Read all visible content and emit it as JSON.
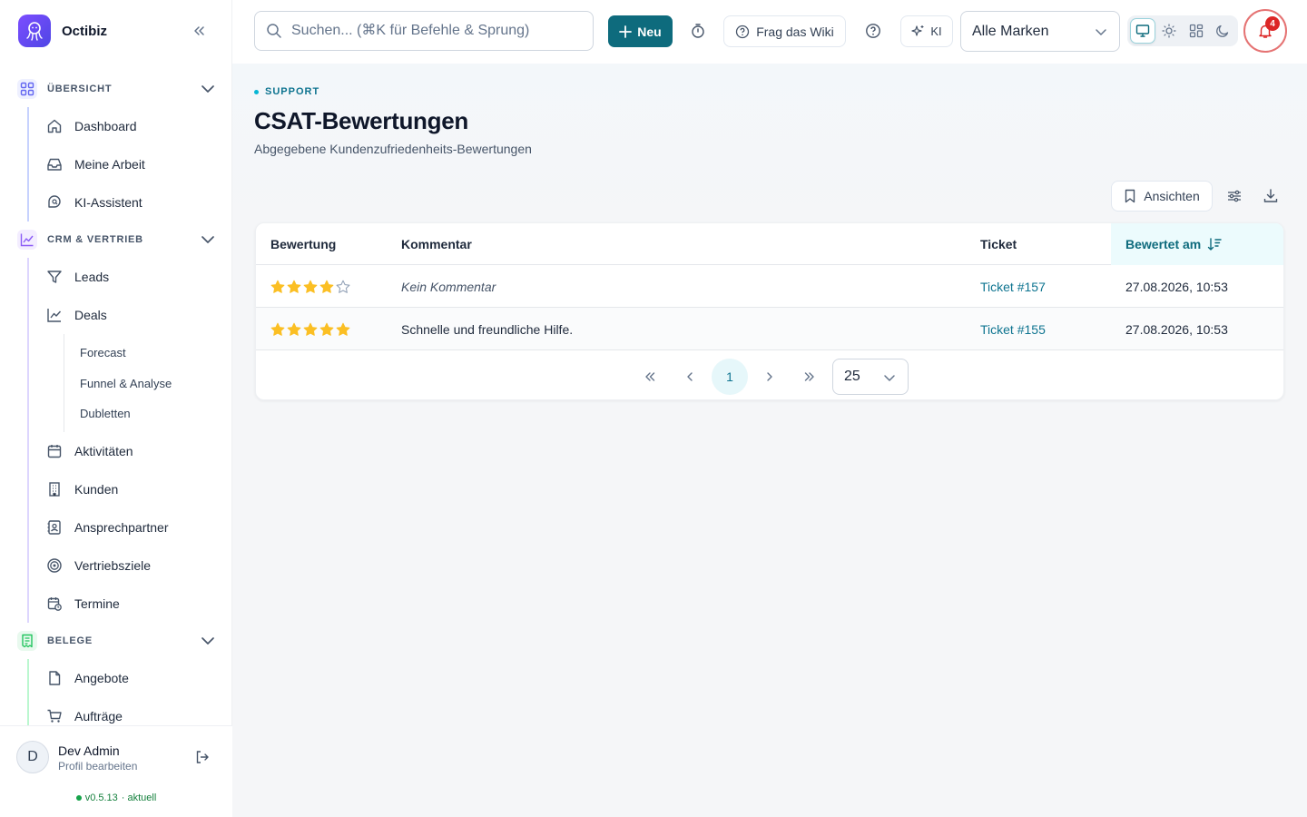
{
  "app": {
    "name": "Octibiz"
  },
  "sidebar": {
    "sections": [
      {
        "label": "ÜBERSICHT",
        "color": "#6366f1",
        "items": [
          "Dashboard",
          "Meine Arbeit",
          "KI-Assistent"
        ]
      },
      {
        "label": "CRM & VERTRIEB",
        "color": "#8b5cf6",
        "items": [
          "Leads",
          "Deals",
          "Aktivitäten",
          "Kunden",
          "Ansprechpartner",
          "Vertriebsziele",
          "Termine"
        ],
        "sub_items": [
          "Forecast",
          "Funnel & Analyse",
          "Dubletten"
        ]
      },
      {
        "label": "BELEGE",
        "color": "#22c55e",
        "items": [
          "Angebote",
          "Aufträge"
        ]
      }
    ],
    "user": {
      "initial": "D",
      "name": "Dev Admin",
      "sub": "Profil bearbeiten"
    },
    "version": {
      "number": "v0.5.13",
      "status": "· aktuell"
    }
  },
  "topbar": {
    "search_placeholder": "Suchen... (⌘K für Befehle & Sprung)",
    "new_label": "Neu",
    "wiki_label": "Frag das Wiki",
    "ki_label": "KI",
    "brand_filter": "Alle Marken",
    "notifications_count": "4",
    "accent_color": "#0e6b7d"
  },
  "page": {
    "eyebrow": "SUPPORT",
    "title": "CSAT-Bewertungen",
    "subtitle": "Abgegebene Kundenzufriedenheits-Bewertungen",
    "views_label": "Ansichten"
  },
  "table": {
    "columns": [
      "Bewertung",
      "Kommentar",
      "Ticket",
      "Bewertet am"
    ],
    "sorted_column": "Bewertet am",
    "rows": [
      {
        "rating": 4,
        "comment": "Kein Kommentar",
        "ticket": "Ticket #157",
        "date": "27.08.2026, 10:53"
      },
      {
        "rating": 5,
        "comment": "Schnelle und freundliche Hilfe.",
        "ticket": "Ticket #155",
        "date": "27.08.2026, 10:53"
      }
    ],
    "max_rating": 5,
    "star_color": "#fbbf24"
  },
  "pagination": {
    "current_page": "1",
    "page_size": "25"
  }
}
